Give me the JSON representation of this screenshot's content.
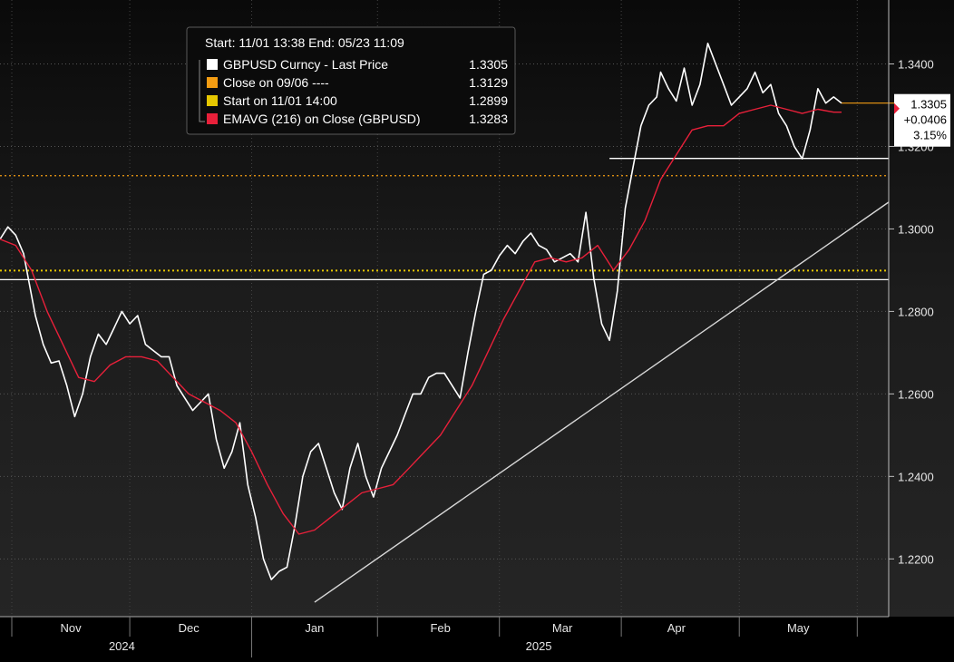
{
  "header": {
    "range_label": "Start: 11/01 13:38 End: 05/23 11:09"
  },
  "legend": [
    {
      "label": "GBPUSD Curncy - Last Price",
      "value": "1.3305",
      "color": "#ffffff"
    },
    {
      "label": "Close on 09/06 ----",
      "value": "1.3129",
      "color": "#f39c12"
    },
    {
      "label": "Start on 11/01 14:00",
      "value": "1.2899",
      "color": "#e6c700"
    },
    {
      "label": "EMAVG (216)  on Close (GBPUSD)",
      "value": "1.3283",
      "color": "#e8203a"
    }
  ],
  "last_tag": {
    "price": "1.3305",
    "change": "+0.0406",
    "pct": "3.15%"
  },
  "y_ticks": [
    {
      "value": 1.34,
      "label": "1.3400"
    },
    {
      "value": 1.32,
      "label": "1.3200"
    },
    {
      "value": 1.3,
      "label": "1.3000"
    },
    {
      "value": 1.28,
      "label": "1.2800"
    },
    {
      "value": 1.26,
      "label": "1.2600"
    },
    {
      "value": 1.24,
      "label": "1.2400"
    },
    {
      "value": 1.22,
      "label": "1.2200"
    }
  ],
  "months": [
    {
      "label": "Nov",
      "t": 18
    },
    {
      "label": "Dec",
      "t": 48
    },
    {
      "label": "Jan",
      "t": 80
    },
    {
      "label": "Feb",
      "t": 112
    },
    {
      "label": "Mar",
      "t": 143
    },
    {
      "label": "Apr",
      "t": 172
    },
    {
      "label": "May",
      "t": 203
    }
  ],
  "years": [
    {
      "label": "2024",
      "t": 31
    },
    {
      "label": "2025",
      "t": 137
    }
  ],
  "chart_data": {
    "type": "line",
    "xlabel": "",
    "ylabel": "",
    "x_unit": "days since Nov 1 2024",
    "xlim": [
      0,
      226
    ],
    "ylim": [
      1.206,
      1.3555
    ],
    "grid": true,
    "legend_position": "top-left",
    "series": [
      {
        "name": "GBPUSD Curncy - Last Price",
        "color": "#ffffff",
        "x": [
          0,
          2,
          4,
          6,
          9,
          11,
          13,
          15,
          17,
          19,
          21,
          23,
          25,
          27,
          29,
          31,
          33,
          35,
          37,
          39,
          41,
          43,
          45,
          47,
          49,
          51,
          53,
          55,
          57,
          59,
          61,
          63,
          65,
          67,
          69,
          71,
          73,
          75,
          77,
          79,
          81,
          83,
          85,
          87,
          89,
          91,
          93,
          95,
          97,
          99,
          101,
          103,
          105,
          107,
          109,
          111,
          113,
          115,
          117,
          119,
          121,
          123,
          125,
          127,
          129,
          131,
          133,
          135,
          137,
          139,
          141,
          143,
          145,
          147,
          149,
          151,
          153,
          155,
          157,
          159,
          161,
          163,
          165,
          167,
          168,
          170,
          172,
          174,
          176,
          178,
          180,
          182,
          184,
          186,
          188,
          190,
          192,
          194,
          196,
          198,
          200,
          202,
          204,
          206,
          208,
          210,
          212,
          214
        ],
        "values": [
          1.2975,
          1.3005,
          1.2985,
          1.294,
          1.279,
          1.272,
          1.2675,
          1.268,
          1.262,
          1.2545,
          1.26,
          1.269,
          1.2745,
          1.272,
          1.276,
          1.28,
          1.277,
          1.279,
          1.272,
          1.2705,
          1.269,
          1.269,
          1.262,
          1.259,
          1.256,
          1.258,
          1.26,
          1.249,
          1.242,
          1.246,
          1.253,
          1.238,
          1.23,
          1.22,
          1.215,
          1.217,
          1.218,
          1.228,
          1.24,
          1.246,
          1.248,
          1.242,
          1.236,
          1.232,
          1.242,
          1.248,
          1.24,
          1.235,
          1.242,
          1.246,
          1.25,
          1.255,
          1.26,
          1.26,
          1.264,
          1.265,
          1.265,
          1.262,
          1.259,
          1.27,
          1.28,
          1.289,
          1.29,
          1.2935,
          1.296,
          1.294,
          1.297,
          1.299,
          1.296,
          1.295,
          1.292,
          1.293,
          1.294,
          1.292,
          1.304,
          1.288,
          1.277,
          1.273,
          1.285,
          1.305,
          1.315,
          1.325,
          1.33,
          1.332,
          1.338,
          1.334,
          1.331,
          1.339,
          1.33,
          1.335,
          1.345,
          1.34,
          1.335,
          1.33,
          1.332,
          1.334,
          1.338,
          1.333,
          1.335,
          1.328,
          1.325,
          1.32,
          1.317,
          1.324,
          1.334,
          1.3305,
          1.332,
          1.3305
        ]
      },
      {
        "name": "EMAVG (216)  on Close (GBPUSD)",
        "color": "#e8203a",
        "x": [
          0,
          4,
          8,
          12,
          16,
          20,
          24,
          28,
          32,
          36,
          40,
          44,
          48,
          52,
          56,
          60,
          64,
          68,
          72,
          76,
          80,
          84,
          88,
          92,
          96,
          100,
          104,
          108,
          112,
          116,
          120,
          124,
          128,
          132,
          136,
          140,
          144,
          148,
          152,
          156,
          160,
          164,
          168,
          172,
          176,
          180,
          184,
          188,
          192,
          196,
          200,
          204,
          208,
          212,
          214
        ],
        "values": [
          1.2975,
          1.296,
          1.29,
          1.28,
          1.272,
          1.264,
          1.263,
          1.267,
          1.269,
          1.269,
          1.268,
          1.264,
          1.26,
          1.258,
          1.256,
          1.253,
          1.246,
          1.238,
          1.231,
          1.226,
          1.227,
          1.23,
          1.233,
          1.236,
          1.237,
          1.238,
          1.242,
          1.246,
          1.25,
          1.256,
          1.262,
          1.27,
          1.278,
          1.285,
          1.292,
          1.293,
          1.292,
          1.293,
          1.296,
          1.29,
          1.295,
          1.302,
          1.312,
          1.318,
          1.324,
          1.325,
          1.325,
          1.328,
          1.329,
          1.33,
          1.329,
          1.328,
          1.329,
          1.3283,
          1.3283
        ]
      },
      {
        "name": "Close on 09/06",
        "type": "hline",
        "color": "#f39c12",
        "value": 1.3129
      },
      {
        "name": "Start on 11/01 14:00",
        "type": "hline",
        "color": "#e6c700",
        "value": 1.2899
      },
      {
        "name": "white level",
        "type": "hline",
        "color": "#ffffff",
        "value": 1.2877
      },
      {
        "name": "white short level",
        "type": "segment",
        "color": "#ffffff",
        "x": [
          155,
          226
        ],
        "values": [
          1.3171,
          1.3171
        ]
      },
      {
        "name": "uptrend",
        "type": "segment",
        "color": "#d8d8d8",
        "x": [
          80,
          226
        ],
        "values": [
          1.2095,
          1.3065
        ]
      }
    ]
  }
}
